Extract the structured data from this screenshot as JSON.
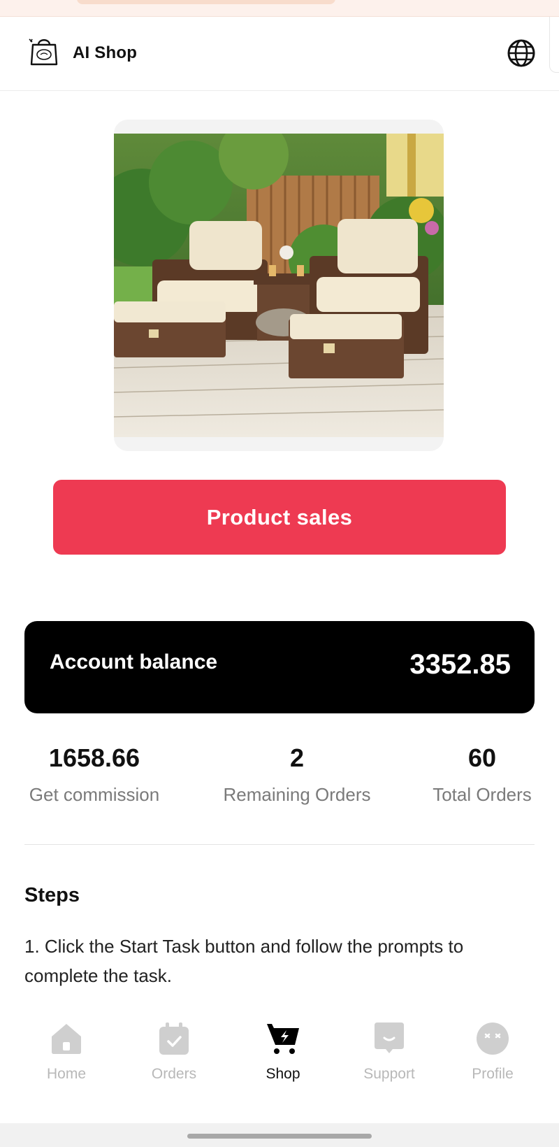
{
  "header": {
    "app_title": "AI Shop",
    "logo_icon": "shopping-bag-icon",
    "language_icon": "globe-icon"
  },
  "product": {
    "image_subject": "outdoor wicker patio chairs with ottomans and side table",
    "cta_label": "Product sales"
  },
  "balance": {
    "label": "Account balance",
    "value": "3352.85"
  },
  "stats": [
    {
      "value": "1658.66",
      "label": "Get commission"
    },
    {
      "value": "2",
      "label": "Remaining Orders"
    },
    {
      "value": "60",
      "label": "Total Orders"
    }
  ],
  "steps": {
    "title": "Steps",
    "items": [
      "1. Click the Start Task button and follow the prompts to complete the task."
    ]
  },
  "nav": {
    "items": [
      {
        "label": "Home",
        "icon": "home-icon",
        "active": false
      },
      {
        "label": "Orders",
        "icon": "calendar-check-icon",
        "active": false
      },
      {
        "label": "Shop",
        "icon": "cart-icon",
        "active": true
      },
      {
        "label": "Support",
        "icon": "chat-icon",
        "active": false
      },
      {
        "label": "Profile",
        "icon": "user-face-icon",
        "active": false
      }
    ]
  },
  "colors": {
    "accent": "#ee3a52",
    "balance_bg": "#000000",
    "nav_inactive": "#b8b8b8"
  }
}
